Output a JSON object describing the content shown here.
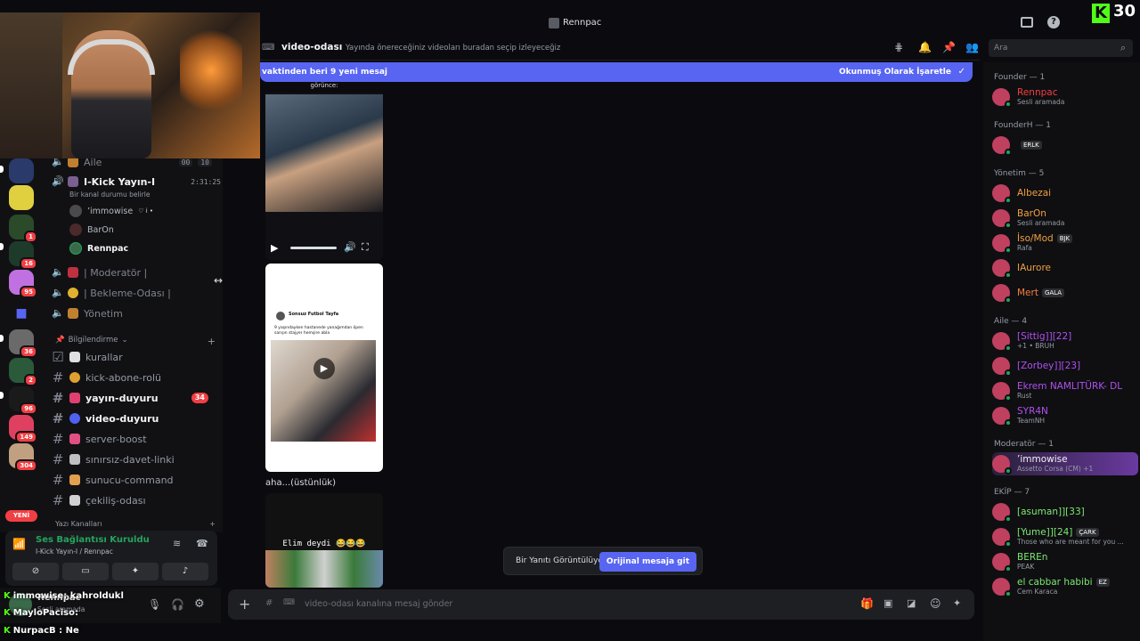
{
  "window": {
    "title": "Rennpac",
    "kick_logo": "K",
    "kick_count": "30"
  },
  "header": {
    "channel": "video-odası",
    "topic": "Yayında önereceğiniz videoları buradan seçip izleyeceğiz",
    "search_placeholder": "Ara"
  },
  "banner": {
    "text": "vaktinden beri 9 yeni mesaj",
    "action": "Okunmuş Olarak İşaretle"
  },
  "voice_channels": [
    {
      "label": "Aile",
      "t1": "00",
      "t2": "10"
    },
    {
      "label": "I-Kick Yayın-I",
      "time": "2:31:25",
      "status": "Bir kanal durumu belirle"
    }
  ],
  "voice_users": [
    {
      "name": "’immowise",
      "badge": "♡ i •"
    },
    {
      "name": "BarOn"
    },
    {
      "name": "Rennpac"
    }
  ],
  "voice_more": [
    "| Moderatör |",
    "| Bekleme-Odası |",
    "Yönetim"
  ],
  "category": "Bilgilendirme",
  "text_channels": [
    {
      "label": "kurallar",
      "unread": false
    },
    {
      "label": "kick-abone-rolü",
      "unread": false
    },
    {
      "label": "yayın-duyuru",
      "unread": true,
      "mentions": "34"
    },
    {
      "label": "video-duyuru",
      "unread": true
    },
    {
      "label": "server-boost",
      "unread": false
    },
    {
      "label": "sınırsız-davet-linki",
      "unread": false
    },
    {
      "label": "sunucu-command",
      "unread": false
    },
    {
      "label": "çekiliş-odası",
      "unread": false
    }
  ],
  "next_category": "Yazı Kanalları",
  "server_badges": [
    "1",
    "16",
    "95",
    "36",
    "2",
    "96",
    "149",
    "304"
  ],
  "yeni": "YENİ",
  "voice_panel": {
    "status": "Ses Bağlantısı Kuruldu",
    "sub": "I-Kick Yayın-I / Rennpac"
  },
  "user": {
    "name": "Rennpac",
    "status": "Sesli aramada"
  },
  "chat_overlay": [
    {
      "user": "immowise",
      "msg": "kahroldukl"
    },
    {
      "user": "MayloPaciso",
      "msg": ""
    },
    {
      "user": "NurpacB",
      "msg": "Ne"
    }
  ],
  "messages": {
    "clip_caption_top": "görünce:",
    "tweet_author": "Sonsuz Futbol Tayfa",
    "tweet_text": "9 yaşındayken hastanede yanağımdan öpen sarışın stajyer hemşire abla",
    "message_text": "aha...(üstünlük)",
    "clip2_text": "Elim deydi 😂😂😂"
  },
  "reply_bar": {
    "text": "Bir Yanıtı Görüntülüyorsun.",
    "button": "Orijinal mesaja git"
  },
  "composer": {
    "placeholder": "video-odası kanalına mesaj gönder"
  },
  "members": {
    "groups": [
      {
        "title": "Founder — 1",
        "items": [
          {
            "name": "Rennpac",
            "color": "#f23f43",
            "status": "Sesli aramada"
          }
        ]
      },
      {
        "title": "FounderH — 1",
        "items": [
          {
            "name": "",
            "color": "#dbdee1",
            "status": "",
            "tag": "ERLK"
          }
        ]
      },
      {
        "title": "Yönetim — 5",
        "items": [
          {
            "name": "Albezai",
            "color": "#f0a040",
            "status": ""
          },
          {
            "name": "BarOn",
            "color": "#f0a040",
            "status": "Sesli aramada"
          },
          {
            "name": "İso/Mod",
            "color": "#f0a040",
            "status": "Rafa",
            "tag": "BJK"
          },
          {
            "name": "IAurore",
            "color": "#f0a040",
            "status": ""
          },
          {
            "name": "Mert",
            "color": "#f08040",
            "status": "",
            "tag": "GALA"
          }
        ]
      },
      {
        "title": "Aile — 4",
        "items": [
          {
            "name": "[Sittig]][22]",
            "color": "#b050f0",
            "status": "+1 • BRUH"
          },
          {
            "name": "[Zorbey]][23]",
            "color": "#b050f0",
            "status": ""
          },
          {
            "name": "Ekrem NAMLITÜRK- DL",
            "color": "#b050f0",
            "status": "Rust"
          },
          {
            "name": "SYR4N",
            "color": "#b050f0",
            "status": "TeamNH"
          }
        ]
      },
      {
        "title": "Moderatör — 1",
        "items": [
          {
            "name": "’immowise",
            "color": "#f2f3f5",
            "status": "Assetto Corsa (CM) +1"
          }
        ]
      },
      {
        "title": "EKİP — 7",
        "items": [
          {
            "name": "[asuman]][33]",
            "color": "#7ce870",
            "status": ""
          },
          {
            "name": "[Yume]][24]",
            "color": "#7ce870",
            "status": "Those who are meant for you ...",
            "tag": "ÇARK"
          },
          {
            "name": "BEREn",
            "color": "#7ce870",
            "status": "PEAK"
          },
          {
            "name": "el cabbar habibi",
            "color": "#7ce870",
            "status": "Cem Karaca",
            "tag": "EZ"
          }
        ]
      }
    ]
  },
  "colors": {
    "accent": "#5865f2",
    "danger": "#f23f43",
    "kick": "#53fc18"
  }
}
